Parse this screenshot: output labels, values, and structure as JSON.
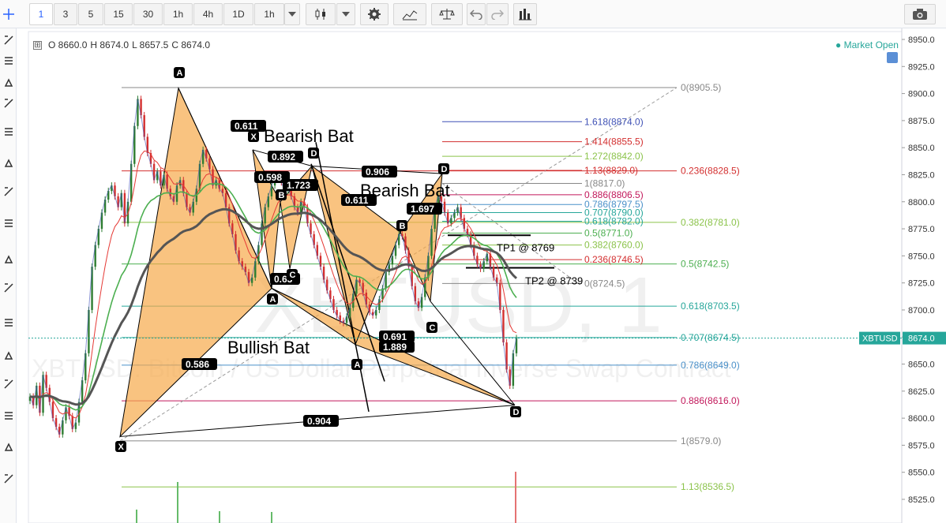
{
  "toolbar": {
    "intervals": [
      "1",
      "3",
      "5",
      "15",
      "30",
      "1h",
      "4h",
      "1D",
      "1h"
    ],
    "active_interval": "1",
    "icons": [
      "candles-icon",
      "settings-icon",
      "indicators-icon",
      "compare-icon",
      "undo-icon",
      "redo-icon",
      "bars-icon",
      "camera-icon"
    ]
  },
  "left_tools": [
    "cursor-icon",
    "line-icon",
    "horizontal-lines-icon",
    "brush-icon",
    "text-icon",
    "pattern-icon",
    "fib-icon",
    "shapes-icon",
    "zoom-icon",
    "measure-icon",
    "magnet-icon",
    "pencil-icon",
    "lock-icon",
    "eye-icon",
    "alert-icon",
    "trash-icon"
  ],
  "ohlc": {
    "o": "O 8660.0",
    "h": "H 8674.0",
    "l": "L 8657.5",
    "c": "C 8674.0"
  },
  "market_status": "● Market Open",
  "watermark": {
    "symbol": "XBTUSD, 1",
    "description": "XBTUSD: Bitcoin / US Dollar Perpetual Inverse Swap Contract"
  },
  "price_tag": {
    "symbol": "XBTUSD",
    "price": "8674.0"
  },
  "colors": {
    "up": "#2e7d32",
    "down": "#d32f2f",
    "pattern_fill": "#f7a94a",
    "price_line": "#26a69a",
    "ema_green": "#4caf50",
    "ema_dark": "#555555",
    "ema_red": "#e53935"
  },
  "chart_data": {
    "type": "candlestick",
    "symbol": "XBTUSD",
    "timeframe": "1",
    "ylim": [
      8516,
      8960
    ],
    "y_ticks": [
      8525.0,
      8550.0,
      8575.0,
      8600.0,
      8625.0,
      8650.0,
      8675.0,
      8700.0,
      8725.0,
      8750.0,
      8775.0,
      8800.0,
      8825.0,
      8850.0,
      8875.0,
      8900.0,
      8925.0,
      8950.0
    ],
    "y_tick_labels": [
      "8525.0",
      "8550.0",
      "8575.0",
      "8600.0",
      "8625.0",
      "8650.0",
      "8675.0",
      "8700.0",
      "8725.0",
      "8750.0",
      "8775.0",
      "8800.0",
      "8825.0",
      "8850.0",
      "8875.0",
      "8900.0",
      "8925.0",
      "8950.0"
    ],
    "last_price": 8674.0,
    "close_series": [
      8620,
      8612,
      8630,
      8605,
      8640,
      8628,
      8615,
      8600,
      8592,
      8585,
      8598,
      8610,
      8602,
      8590,
      8596,
      8615,
      8635,
      8660,
      8700,
      8740,
      8760,
      8775,
      8790,
      8802,
      8810,
      8815,
      8805,
      8795,
      8808,
      8780,
      8800,
      8835,
      8870,
      8895,
      8880,
      8860,
      8845,
      8835,
      8820,
      8828,
      8815,
      8825,
      8812,
      8805,
      8800,
      8815,
      8820,
      8808,
      8795,
      8790,
      8800,
      8812,
      8835,
      8848,
      8840,
      8830,
      8815,
      8820,
      8812,
      8808,
      8795,
      8780,
      8770,
      8755,
      8745,
      8740,
      8735,
      8725,
      8730,
      8745,
      8760,
      8780,
      8795,
      8805,
      8815,
      8822,
      8825,
      8818,
      8810,
      8812,
      8805,
      8795,
      8790,
      8800,
      8795,
      8780,
      8770,
      8760,
      8750,
      8740,
      8728,
      8718,
      8710,
      8700,
      8695,
      8690,
      8688,
      8694,
      8702,
      8715,
      8728,
      8725,
      8716,
      8705,
      8698,
      8695,
      8700,
      8710,
      8720,
      8735,
      8742,
      8750,
      8760,
      8770,
      8768,
      8755,
      8740,
      8722,
      8708,
      8702,
      8712,
      8730,
      8750,
      8775,
      8795,
      8805,
      8800,
      8790,
      8780,
      8785,
      8790,
      8795,
      8785,
      8775,
      8770,
      8760,
      8750,
      8742,
      8738,
      8745,
      8752,
      8740,
      8730,
      8725,
      8700,
      8670,
      8645,
      8630,
      8660,
      8674
    ],
    "fib_retracement_right": {
      "levels": [
        {
          "label": "0(8905.5)",
          "price": 8905.5,
          "color": "#888888"
        },
        {
          "label": "0.236(8828.5)",
          "price": 8828.5,
          "color": "#d32f2f"
        },
        {
          "label": "0.382(8781.0)",
          "price": 8781.0,
          "color": "#8bc34a"
        },
        {
          "label": "0.5(8742.5)",
          "price": 8742.5,
          "color": "#4caf50"
        },
        {
          "label": "0.618(8703.5)",
          "price": 8703.5,
          "color": "#26a69a"
        },
        {
          "label": "0.707(8674.5)",
          "price": 8674.5,
          "color": "#26a69a"
        },
        {
          "label": "0.786(8649.0)",
          "price": 8649.0,
          "color": "#4a90c9"
        },
        {
          "label": "0.886(8616.0)",
          "price": 8616.0,
          "color": "#c2185b"
        },
        {
          "label": "1(8579.0)",
          "price": 8579.0,
          "color": "#888888"
        },
        {
          "label": "1.13(8536.5)",
          "price": 8536.5,
          "color": "#8bc34a"
        }
      ]
    },
    "fib_retracement_middle": {
      "levels": [
        {
          "label": "1.618(8874.0)",
          "price": 8874.0,
          "color": "#3f51b5"
        },
        {
          "label": "1.414(8855.5)",
          "price": 8855.5,
          "color": "#d32f2f"
        },
        {
          "label": "1.272(8842.0)",
          "price": 8842.0,
          "color": "#8bc34a"
        },
        {
          "label": "1.13(8829.0)",
          "price": 8829.0,
          "color": "#d32f2f"
        },
        {
          "label": "1(8817.0)",
          "price": 8817.0,
          "color": "#888888"
        },
        {
          "label": "0.886(8806.5)",
          "price": 8806.5,
          "color": "#c2185b"
        },
        {
          "label": "0.786(8797.5)",
          "price": 8797.5,
          "color": "#4a90c9"
        },
        {
          "label": "0.707(8790.0)",
          "price": 8790.0,
          "color": "#26a69a"
        },
        {
          "label": "0.618(8782.0)",
          "price": 8782.0,
          "color": "#26a69a"
        },
        {
          "label": "0.5(8771.0)",
          "price": 8771.0,
          "color": "#4caf50"
        },
        {
          "label": "0.382(8760.0)",
          "price": 8760.0,
          "color": "#8bc34a"
        },
        {
          "label": "0.236(8746.5)",
          "price": 8746.5,
          "color": "#d32f2f"
        },
        {
          "label": "0(8724.5)",
          "price": 8724.5,
          "color": "#888888"
        }
      ]
    },
    "targets": [
      {
        "label": "TP1 @ 8769",
        "price": 8769
      },
      {
        "label": "TP2 @ 8739",
        "price": 8739
      }
    ],
    "patterns": [
      {
        "name": "Bearish Bat",
        "points": [
          "X",
          "A",
          "B",
          "C",
          "D"
        ],
        "ratios": [
          "0.611",
          "0.892",
          "0.598",
          "1.723"
        ]
      },
      {
        "name": "Bearish Bat",
        "points": [
          "X",
          "A",
          "B",
          "C",
          "D"
        ],
        "ratios": [
          "0.906",
          "0.611",
          "1.697"
        ]
      },
      {
        "name": "Bullish Bat",
        "points": [
          "X",
          "A",
          "B",
          "C",
          "D"
        ],
        "ratios": [
          "0.586",
          "0.63",
          "0.691",
          "1.889",
          "0.904"
        ]
      }
    ],
    "point_labels": [
      "A",
      "X",
      "D",
      "B",
      "C",
      "A",
      "A",
      "B",
      "C",
      "D",
      "X",
      "D"
    ]
  }
}
